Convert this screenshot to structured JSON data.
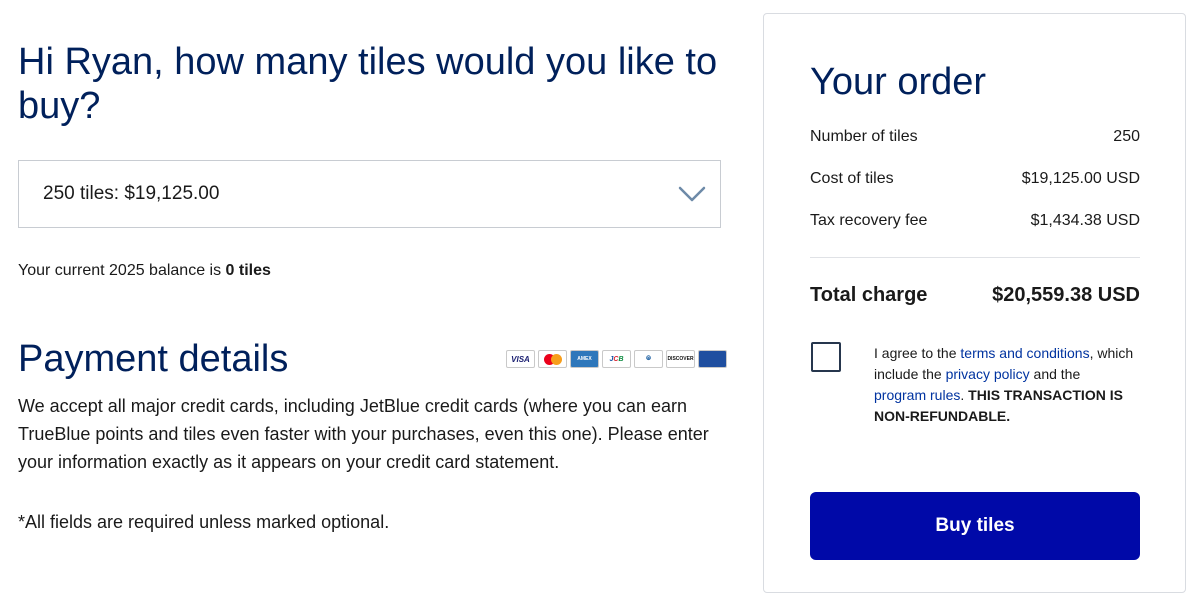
{
  "header": {
    "greeting": "Hi Ryan, how many tiles would you like to buy?"
  },
  "tiles_select": {
    "selected": "250 tiles: $19,125.00"
  },
  "balance": {
    "prefix": "Your current 2025 balance is ",
    "value": "0 tiles"
  },
  "payment": {
    "title": "Payment details",
    "cards": [
      {
        "name": "visa",
        "label": "VISA"
      },
      {
        "name": "mastercard",
        "label": ""
      },
      {
        "name": "amex",
        "label": "AMEX"
      },
      {
        "name": "jcb",
        "label": "JCB"
      },
      {
        "name": "diners",
        "label": "Diners Club"
      },
      {
        "name": "discover",
        "label": "DISCOVER"
      },
      {
        "name": "other",
        "label": ""
      }
    ],
    "description": "We accept all major credit cards, including JetBlue credit cards (where you can earn TrueBlue points and tiles even faster with your purchases, even this one). Please enter your information exactly as it appears on your credit card statement.",
    "required_note": "*All fields are required unless marked optional."
  },
  "order": {
    "title": "Your order",
    "rows": [
      {
        "label": "Number of tiles",
        "value": "250"
      },
      {
        "label": "Cost of tiles",
        "value": "$19,125.00 USD"
      },
      {
        "label": "Tax recovery fee",
        "value": "$1,434.38 USD"
      }
    ],
    "total_label": "Total charge",
    "total_value": "$20,559.38 USD",
    "agree": {
      "t1": "I agree to the ",
      "terms_link": "terms and conditions",
      "t2": ", which include the ",
      "privacy_link": "privacy policy",
      "t3": " and the ",
      "rules_link": "program rules",
      "t4": ". ",
      "warning": "THIS TRANSACTION IS NON-REFUNDABLE."
    },
    "buy_label": "Buy tiles"
  },
  "colors": {
    "heading": "#00205b",
    "button": "#0009a8",
    "link": "#0033a0"
  }
}
